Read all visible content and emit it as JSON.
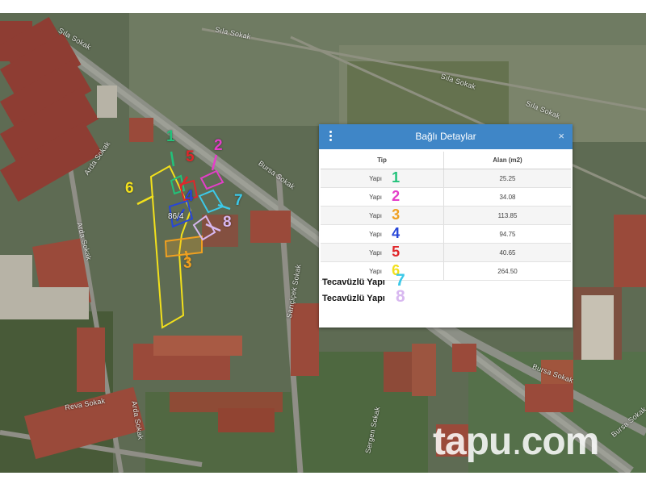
{
  "streets": [
    "Sıla Sokak",
    "Sıla Sokak",
    "Sıla Sokak",
    "Sıla Sokak",
    "Bursa Sokak",
    "Arda Sokak",
    "Arda Sokak",
    "Sarıçiçek Sokak",
    "Reva Sokak",
    "Arda Sokak",
    "Sergen Sokak",
    "Bursa Sokak",
    "Bursa Sokak"
  ],
  "area_label": "86/4",
  "markers": [
    "1",
    "2",
    "3",
    "4",
    "5",
    "6",
    "7",
    "8"
  ],
  "colors": {
    "1": "#22c27a",
    "2": "#e43ec9",
    "3": "#f0a020",
    "4": "#2746d8",
    "5": "#e0262a",
    "6": "#f2e01c",
    "7": "#3cc9e8",
    "8": "#d8b8f0"
  },
  "panel": {
    "title": "Bağlı Detaylar",
    "menu_icon": "kebab-menu-icon",
    "close_icon": "close-icon",
    "columns": [
      "Tip",
      "Alan (m2)"
    ],
    "rows": [
      {
        "tip": "Yapı",
        "num": "1",
        "alan": "25.25"
      },
      {
        "tip": "Yapı",
        "num": "2",
        "alan": "34.08"
      },
      {
        "tip": "Yapı",
        "num": "3",
        "alan": "113.85"
      },
      {
        "tip": "Yapı",
        "num": "4",
        "alan": "94.75"
      },
      {
        "tip": "Yapı",
        "num": "5",
        "alan": "40.65"
      },
      {
        "tip": "Yapı",
        "num": "6",
        "alan": "264.50"
      }
    ],
    "extra": [
      {
        "label": "Tecavüzlü Yapı",
        "num": "7"
      },
      {
        "label": "Tecavüzlü Yapı",
        "num": "8"
      }
    ]
  },
  "watermark": {
    "brand": "tapu",
    "dot": ".",
    "tld": "com"
  }
}
